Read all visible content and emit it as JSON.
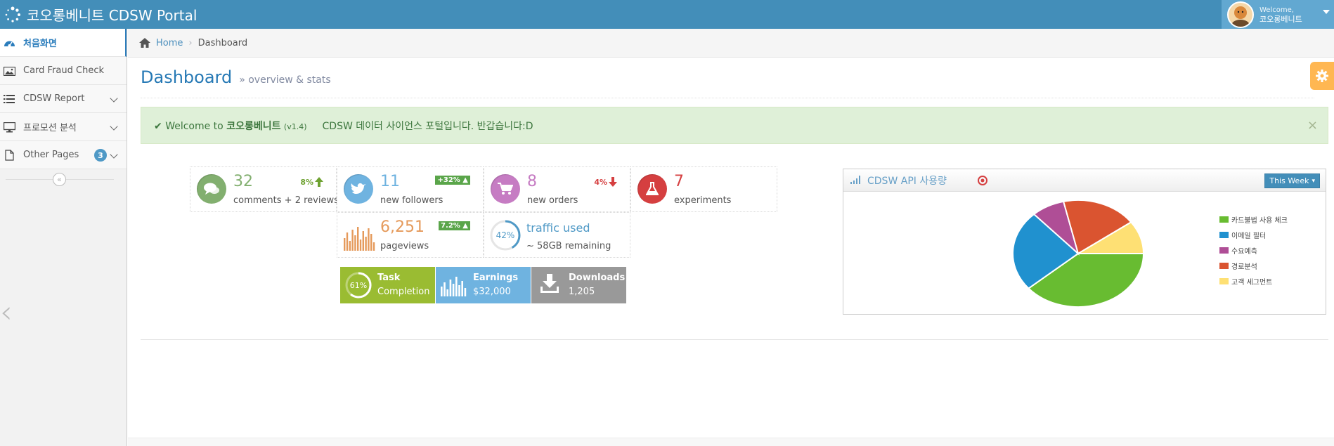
{
  "navbar": {
    "brand": "코오롱베니트 CDSW Portal",
    "welcome": "Welcome,",
    "user_name": "코오롱베니트"
  },
  "sidebar": {
    "items": [
      {
        "label": "처음화면",
        "icon": "dashboard-icon"
      },
      {
        "label": "Card Fraud Check",
        "icon": "picture-icon"
      },
      {
        "label": "CDSW Report",
        "icon": "list-icon"
      },
      {
        "label": "프로모션 분석",
        "icon": "desktop-icon"
      },
      {
        "label": "Other Pages",
        "icon": "file-icon",
        "badge": "3"
      }
    ],
    "collapse_glyph": "«",
    "side_chevron": "‹"
  },
  "breadcrumbs": {
    "home": "Home",
    "current": "Dashboard"
  },
  "page_header": {
    "title": "Dashboard",
    "subtitle": "» overview & stats"
  },
  "alert": {
    "welcome_to": "Welcome to",
    "brand": "코오롱베니트",
    "version": "(v1.4)",
    "message": "CDSW 데이터 사이언스 포털입니다. 반갑습니다:D",
    "close": "×"
  },
  "infoboxes": {
    "comments": {
      "number": "32",
      "caption": "comments + 2 reviews",
      "stat": "8%"
    },
    "followers": {
      "number": "11",
      "caption": "new followers",
      "stat": "+32%"
    },
    "orders": {
      "number": "8",
      "caption": "new orders",
      "stat": "4%"
    },
    "experiments": {
      "number": "7",
      "caption": "experiments"
    },
    "pageviews": {
      "number": "6,251",
      "caption": "pageviews",
      "stat": "7.2%"
    },
    "traffic": {
      "percent": "42%",
      "percent_value": 42,
      "title": "traffic used",
      "caption": "~ 58GB remaining"
    }
  },
  "dark_boxes": {
    "task": {
      "percent": "61%",
      "percent_value": 61,
      "label": "Task",
      "value": "Completion"
    },
    "earnings": {
      "label": "Earnings",
      "value": "$32,000"
    },
    "downloads": {
      "label": "Downloads",
      "value": "1,205"
    }
  },
  "widget": {
    "title": "CDSW API 사용량",
    "period": "This Week"
  },
  "colors": {
    "navbar": "#438eb9",
    "green": "#82af6f",
    "blue": "#6fb3e0",
    "pink": "#c67cc3",
    "red": "#d53f40",
    "orange": "#e8b110"
  },
  "chart_data": {
    "type": "pie",
    "title": "",
    "legend_position": "right",
    "categories": [
      "카드불법 사용 체크",
      "이메일 필터",
      "수요예측",
      "경로분석",
      "고객 세그먼트"
    ],
    "values": [
      38.7,
      24.5,
      8.2,
      18.6,
      10.0
    ],
    "colors": [
      "#68bc31",
      "#2091cf",
      "#af4e96",
      "#da5430",
      "#fee074"
    ]
  }
}
